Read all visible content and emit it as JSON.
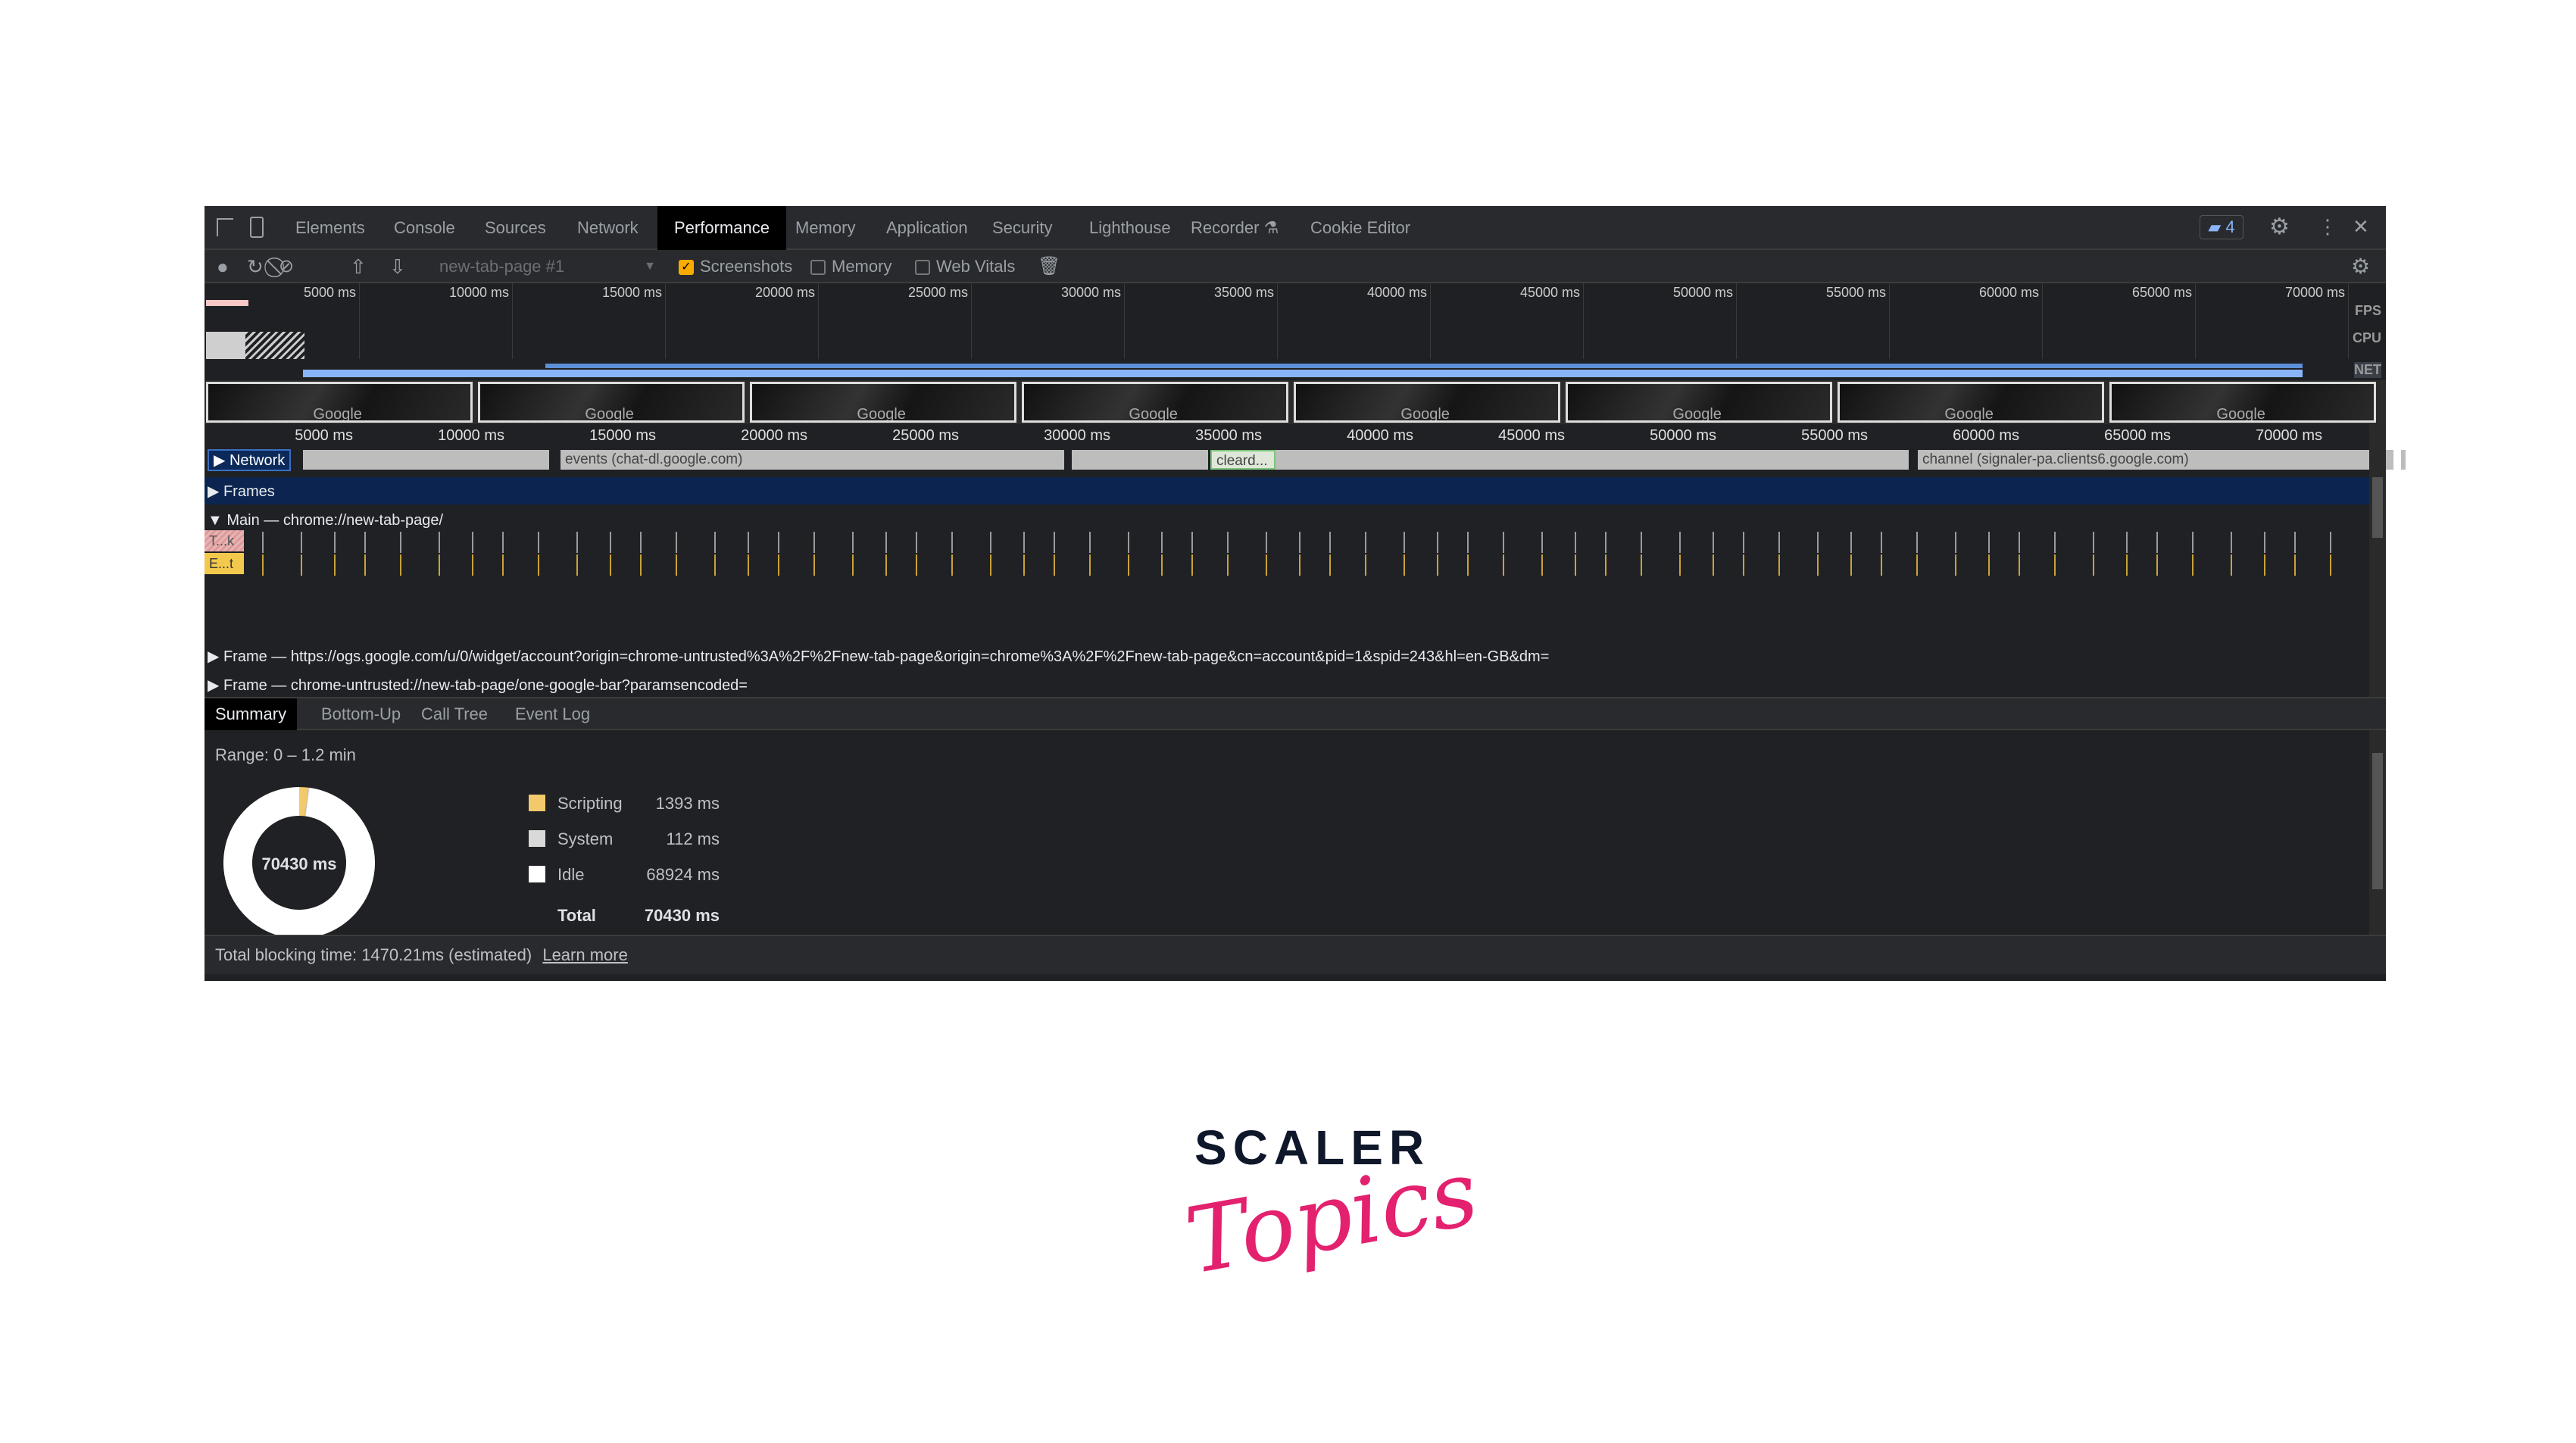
{
  "tabs": [
    {
      "label": "Elements"
    },
    {
      "label": "Console"
    },
    {
      "label": "Sources"
    },
    {
      "label": "Network"
    },
    {
      "label": "Performance",
      "selected": true
    },
    {
      "label": "Memory"
    },
    {
      "label": "Application"
    },
    {
      "label": "Security"
    },
    {
      "label": "Lighthouse"
    },
    {
      "label": "Recorder ⚗"
    },
    {
      "label": "Cookie Editor"
    }
  ],
  "issues_badge": "4",
  "toolbar": {
    "profile_select": "new-tab-page #1",
    "screenshots": {
      "label": "Screenshots",
      "checked": true
    },
    "memory": {
      "label": "Memory",
      "checked": false
    },
    "web_vitals": {
      "label": "Web Vitals",
      "checked": false
    }
  },
  "overview": {
    "ticks": [
      "5000 ms",
      "10000 ms",
      "15000 ms",
      "20000 ms",
      "25000 ms",
      "30000 ms",
      "35000 ms",
      "40000 ms",
      "45000 ms",
      "50000 ms",
      "55000 ms",
      "60000 ms",
      "65000 ms",
      "70000 ms"
    ],
    "fps_label": "FPS",
    "cpu_label": "CPU",
    "net_label": "NET",
    "screenshot_text": "Google"
  },
  "tracks": {
    "network": {
      "label": "Network",
      "bars": [
        "events (chat-dl.google.com)",
        "cleard...",
        "channel (signaler-pa.clients6.google.com)"
      ]
    },
    "frames": {
      "label": "Frames"
    },
    "main": {
      "label": "Main — chrome://new-tab-page/",
      "task1": "T...k",
      "task2": "E...t"
    },
    "frame1": {
      "label": "Frame — https://ogs.google.com/u/0/widget/account?origin=chrome-untrusted%3A%2F%2Fnew-tab-page&origin=chrome%3A%2F%2Fnew-tab-page&cn=account&pid=1&spid=243&hl=en-GB&dm="
    },
    "frame2": {
      "label": "Frame — chrome-untrusted://new-tab-page/one-google-bar?paramsencoded="
    }
  },
  "bottom_tabs": [
    {
      "label": "Summary",
      "selected": true
    },
    {
      "label": "Bottom-Up"
    },
    {
      "label": "Call Tree"
    },
    {
      "label": "Event Log"
    }
  ],
  "summary": {
    "range": "Range: 0 – 1.2 min",
    "total_center": "70430 ms",
    "items": [
      {
        "value": "1393 ms",
        "label": "Scripting",
        "ms": 1393,
        "color": "#f2c96b"
      },
      {
        "value": "112 ms",
        "label": "System",
        "ms": 112,
        "color": "#d9d9d9"
      },
      {
        "value": "68924 ms",
        "label": "Idle",
        "ms": 68924,
        "color": "#ffffff"
      }
    ],
    "total": {
      "value": "70430 ms",
      "label": "Total"
    }
  },
  "footer": {
    "text": "Total blocking time: 1470.21ms (estimated)",
    "link": "Learn more"
  },
  "logo": {
    "line1": "SCALER",
    "line2": "Topics",
    "color1": "#0f172a",
    "color2": "#e3216f"
  }
}
